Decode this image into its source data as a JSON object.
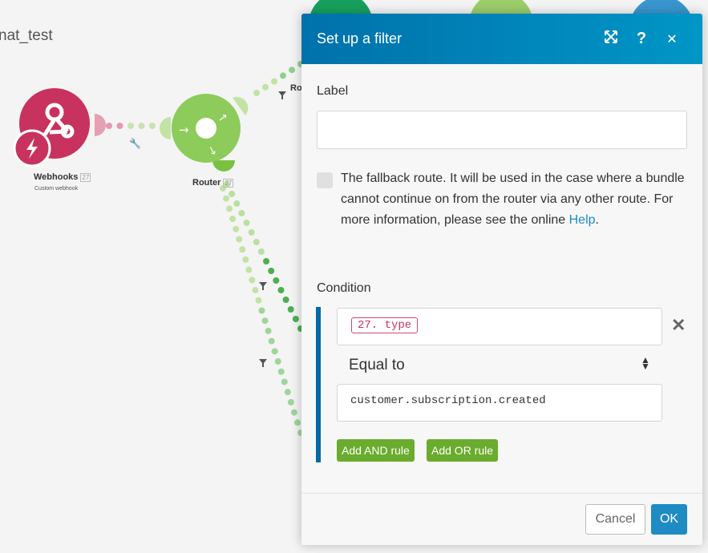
{
  "scenario": {
    "title": "nat_test"
  },
  "nodes": [
    {
      "label": "Webhooks",
      "badge": "27",
      "subtitle": "Custom webhook",
      "color": "#c8325e"
    },
    {
      "label": "Router",
      "badge": "27",
      "color": "#8dcb5a"
    },
    {
      "label": "Ro"
    }
  ],
  "modal": {
    "title": "Set up a filter",
    "icons": [
      "expand-icon",
      "help-icon",
      "close-icon"
    ],
    "help_glyph": "?",
    "close_glyph": "✕",
    "label_heading": "Label",
    "label_value": "",
    "fallback_text": "The fallback route. It will be used in the case where a bundle cannot continue on from the router via any other route. For more information, please see the online ",
    "fallback_link": "Help",
    "fallback_end": ".",
    "fallback_checked": false,
    "condition_heading": "Condition",
    "condition": {
      "operand": "27. type",
      "operator": "Equal to",
      "value": "customer.subscription.created"
    },
    "add_and": "Add AND rule",
    "add_or": "Add OR rule",
    "cancel": "Cancel",
    "ok": "OK",
    "accent": "#1e8bc3",
    "green": "#6aac2e"
  }
}
